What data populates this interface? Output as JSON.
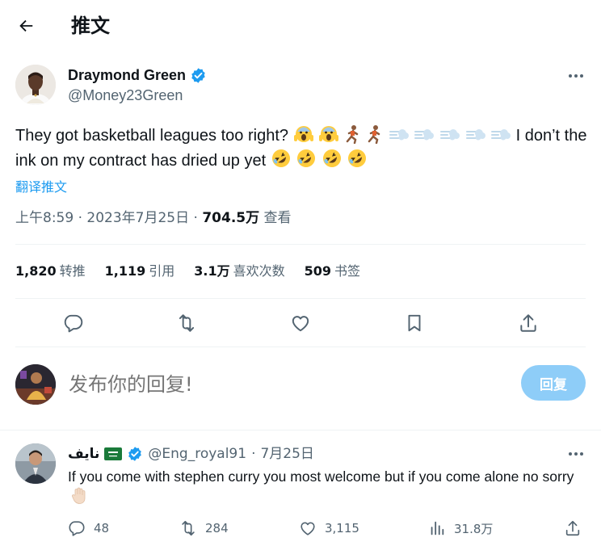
{
  "header": {
    "title": "推文"
  },
  "author": {
    "name": "Draymond Green",
    "handle": "@Money23Green"
  },
  "tweet": {
    "text_part1": "They got basketball leagues too right? ",
    "text_part2": " I don’t the ink on my contract has dried up yet ",
    "translate_label": "翻译推文",
    "time": "上午8:59",
    "date": "2023年7月25日",
    "views_value": "704.5万",
    "views_label": "查看"
  },
  "stats": {
    "retweets_value": "1,820",
    "retweets_label": "转推",
    "quotes_value": "1,119",
    "quotes_label": "引用",
    "likes_value": "3.1万",
    "likes_label": "喜欢次数",
    "bookmarks_value": "509",
    "bookmarks_label": "书签"
  },
  "reply_composer": {
    "placeholder": "发布你的回复!",
    "submit_label": "回复"
  },
  "reply": {
    "name": "نايف",
    "handle": "@Eng_royal91",
    "separator": "·",
    "date": "7月25日",
    "text": "If you come with stephen curry you most welcome but if you come alone no sorry",
    "replies": "48",
    "retweets": "284",
    "likes": "3,115",
    "views": "31.8万"
  },
  "icons": {
    "back": "arrow-left-icon",
    "verified": "verified-badge-icon",
    "more": "more-horizontal-icon",
    "reply": "speech-bubble-icon",
    "retweet": "retweet-icon",
    "like": "heart-icon",
    "bookmark": "bookmark-icon",
    "share": "share-icon",
    "views": "bar-chart-icon"
  },
  "colors": {
    "accent": "#1d9bf0",
    "text_primary": "#0f1419",
    "text_secondary": "#536471",
    "reply_button_disabled": "#8ecdf8",
    "divider": "#eff3f4"
  }
}
